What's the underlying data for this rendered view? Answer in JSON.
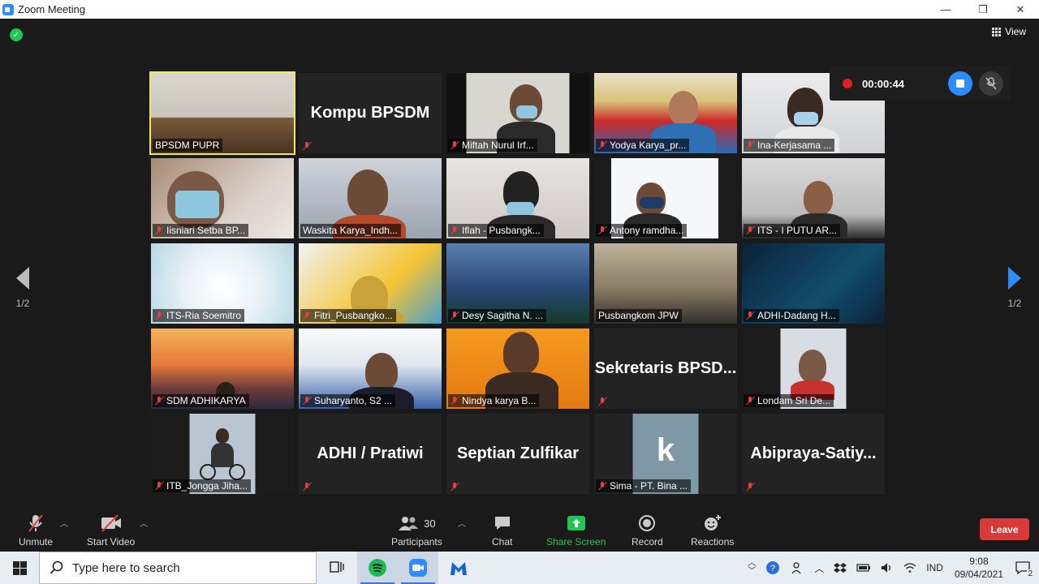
{
  "window": {
    "title": "Zoom Meeting",
    "minimize": "—",
    "maximize": "❐",
    "close": "✕"
  },
  "meeting": {
    "view_label": "View",
    "page_left": "1/2",
    "page_right": "1/2",
    "recording_time": "00:00:44"
  },
  "tiles": [
    {
      "name": "BPSDM PUPR",
      "type": "video",
      "muted": false
    },
    {
      "name": "Kompu BPSDM",
      "type": "text",
      "muted": true,
      "label": ""
    },
    {
      "name": "Miftah Nurul Irf...",
      "type": "video",
      "muted": true
    },
    {
      "name": "Yodya Karya_pr...",
      "type": "video",
      "muted": true
    },
    {
      "name": "Ina-Kerjasama ...",
      "type": "video",
      "muted": true
    },
    {
      "name": "Iisniari Setba BP...",
      "type": "video",
      "muted": true
    },
    {
      "name": "Waskita Karya_Indh...",
      "type": "video",
      "muted": false
    },
    {
      "name": "Iflah - Pusbangk...",
      "type": "video",
      "muted": true
    },
    {
      "name": "Antony ramdha...",
      "type": "video",
      "muted": true
    },
    {
      "name": "ITS - I PUTU AR...",
      "type": "video",
      "muted": true
    },
    {
      "name": "ITS-Ria Soemitro",
      "type": "video",
      "muted": true
    },
    {
      "name": "Fitri_Pusbangko...",
      "type": "video",
      "muted": true
    },
    {
      "name": "Desy Sagitha N. ...",
      "type": "video",
      "muted": true
    },
    {
      "name": "Pusbangkom JPW",
      "type": "video",
      "muted": false
    },
    {
      "name": "ADHI-Dadang H...",
      "type": "video",
      "muted": true
    },
    {
      "name": "SDM ADHIKARYA",
      "type": "video",
      "muted": true
    },
    {
      "name": "Suharyanto, S2 ...",
      "type": "video",
      "muted": true
    },
    {
      "name": "Nindya karya B...",
      "type": "video",
      "muted": true
    },
    {
      "name": "Sekretaris  BPSD...",
      "type": "text",
      "muted": true
    },
    {
      "name": "Londam Sri De...",
      "type": "video",
      "muted": true
    },
    {
      "name": "ITB_Jongga Jiha...",
      "type": "video",
      "muted": true
    },
    {
      "name": "ADHI / Pratiwi",
      "type": "text",
      "muted": true
    },
    {
      "name": "Septian Zulfikar",
      "type": "text",
      "muted": true
    },
    {
      "name": "Sima - PT. Bina ...",
      "type": "video",
      "muted": true
    },
    {
      "name": "Abipraya-Satiy...",
      "type": "text",
      "muted": true
    }
  ],
  "toolbar": {
    "unmute": "Unmute",
    "start_video": "Start Video",
    "participants": "Participants",
    "participants_count": "30",
    "chat": "Chat",
    "share_screen": "Share Screen",
    "record": "Record",
    "reactions": "Reactions",
    "leave": "Leave"
  },
  "taskbar": {
    "search_placeholder": "Type here to search",
    "language": "IND",
    "time": "9:08",
    "date": "09/04/2021",
    "notifications": "2"
  },
  "colors": {
    "accent": "#2d8cff",
    "green": "#23c552",
    "leave": "#d83a3a",
    "active_speaker": "#e8e86a"
  }
}
